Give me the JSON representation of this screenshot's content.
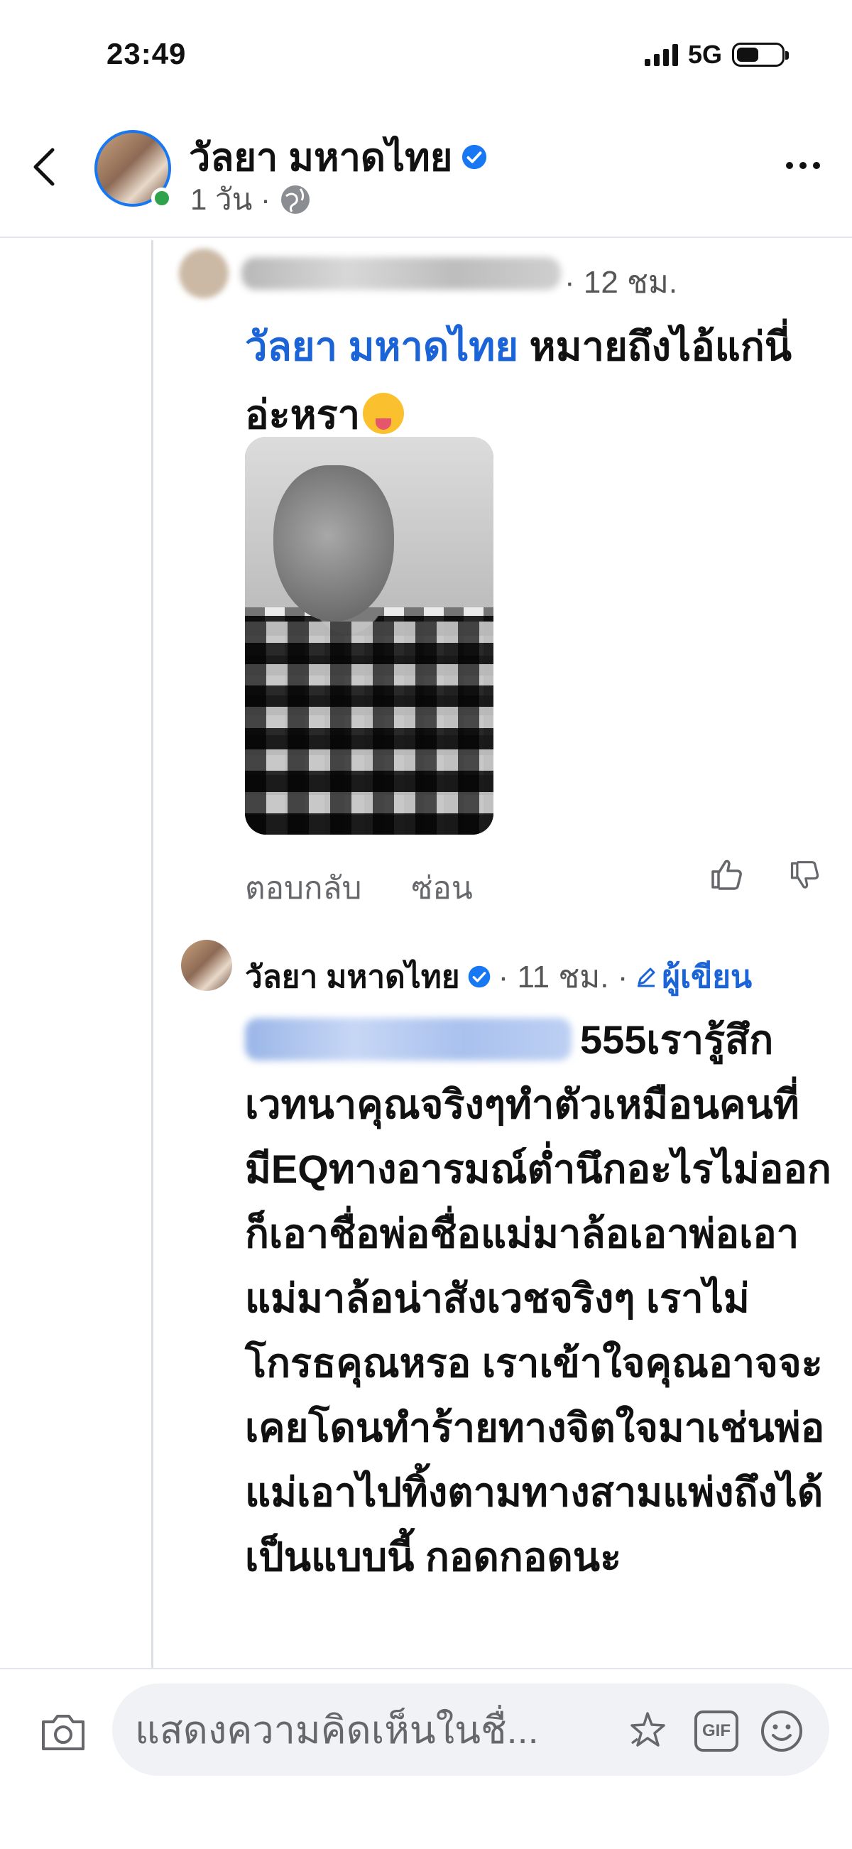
{
  "status_bar": {
    "time": "23:49",
    "network": "5G"
  },
  "header": {
    "name": "วัลยา มหาดไทย",
    "meta": "1 วัน ·"
  },
  "comments": [
    {
      "author": "",
      "time": "· 12 ชม.",
      "mention": "วัลยา มหาดไทย",
      "text": " หมายถึงไอ้แก่นี่อ่ะหรา",
      "emoji": "zany-face",
      "actions": {
        "reply": "ตอบกลับ",
        "hide": "ซ่อน"
      }
    },
    {
      "author": "วัลยา มหาดไทย",
      "time": "· 11 ชม. ·",
      "author_badge": "ผู้เขียน",
      "text": "555เรารู้สึกเวทนาคุณจริงๆทำตัวเหมือนคนที่มีEQทางอารมณ์ต่ำนึกอะไรไม่ออกก็เอาชื่อพ่อชื่อแม่มาล้อเอาพ่อเอาแม่มาล้อน่าสังเวชจริงๆ เราไม่โกรธคุณหรอ เราเข้าใจคุณอาจจะเคยโดนทำร้ายทางจิตใจมาเช่นพ่อแม่เอาไปทิ้งตามทางสามแพ่งถึงได้เป็นแบบนี้ กอดกอดนะ"
    }
  ],
  "composer": {
    "placeholder": "แสดงความคิดเห็นในชื่...",
    "gif_label": "GIF"
  },
  "colors": {
    "accent": "#1877f2",
    "mention": "#1b64d8",
    "online": "#31a24c"
  }
}
